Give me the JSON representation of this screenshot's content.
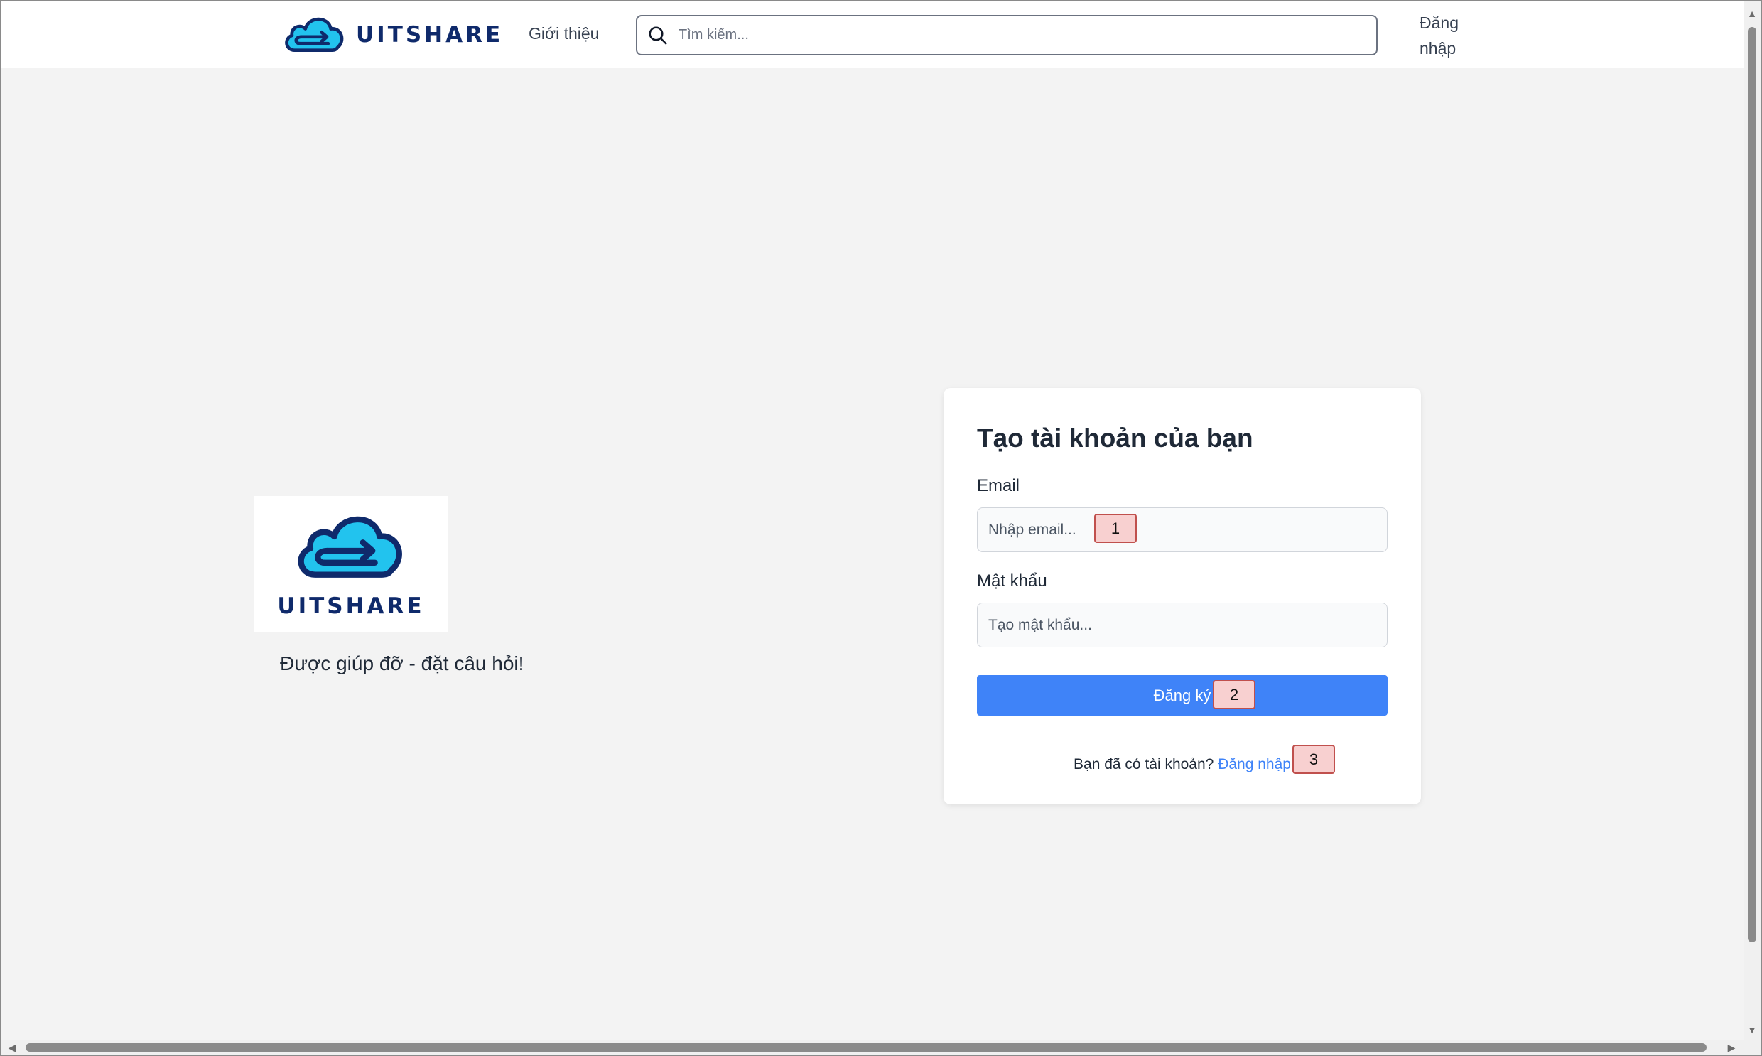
{
  "header": {
    "brand": "UITSHARE",
    "nav_about": "Giới thiệu",
    "search_placeholder": "Tìm kiếm...",
    "login": "Đăng nhập",
    "brand_color": "#0f2a6b",
    "cloud_color": "#22c3ee"
  },
  "hero": {
    "logo_text": "UITSHARE",
    "tagline": "Được giúp đỡ - đặt câu hỏi!"
  },
  "signup": {
    "title": "Tạo tài khoản của bạn",
    "email_label": "Email",
    "email_placeholder": "Nhập email...",
    "password_label": "Mật khẩu",
    "password_placeholder": "Tạo mật khẩu...",
    "submit_label": "Đăng ký",
    "footer_text": "Bạn đã có tài khoản? ",
    "footer_link": "Đăng nhập",
    "accent_color": "#3f83f8"
  },
  "tags": [
    "1",
    "2",
    "3"
  ],
  "icons": {
    "search": "search-icon",
    "logo": "cloud-arrow-logo-icon",
    "scroll_up": "chevron-up-icon",
    "scroll_down": "chevron-down-icon",
    "scroll_left": "chevron-left-icon",
    "scroll_right": "chevron-right-icon"
  }
}
